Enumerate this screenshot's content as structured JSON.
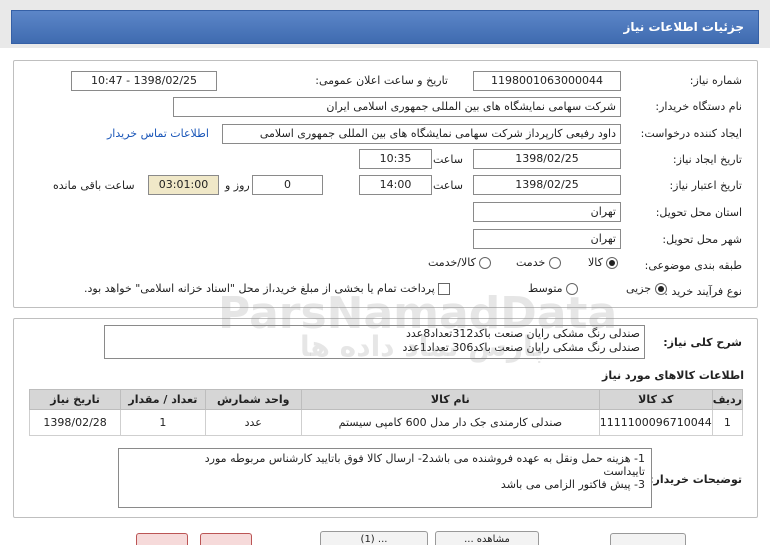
{
  "window": {
    "title": "جزئیات اطلاعات نیاز"
  },
  "details": {
    "need_number_label": "شماره نیاز:",
    "need_number": "1198001063000044",
    "announce_label": "تاریخ و ساعت اعلان عمومی:",
    "announce_value": "1398/02/25 - 10:47",
    "buyer_org_label": "نام دستگاه خریدار:",
    "buyer_org": "شرکت سهامی نمایشگاه های بین المللی جمهوری اسلامی ایران",
    "requester_label": "ایجاد کننده درخواست:",
    "requester": "داود رفیعی کارپرداز شرکت سهامی نمایشگاه های بین المللی جمهوری اسلامی",
    "contact_link": "اطلاعات تماس خریدار",
    "created_label": "تاریخ ایجاد نیاز:",
    "created_date": "1398/02/25",
    "time_label": "ساعت",
    "created_time": "10:35",
    "validity_label": "تاریخ اعتبار نیاز:",
    "validity_date": "1398/02/25",
    "validity_time": "14:00",
    "days_value": "0",
    "days_label": "روز و",
    "remaining_time": "03:01:00",
    "remaining_label": "ساعت باقی مانده",
    "province_label": "استان محل تحویل:",
    "province": "تهران",
    "city_label": "شهر محل تحویل:",
    "city": "تهران",
    "category_label": "طبقه بندی موضوعی:",
    "category_options": [
      "کالا",
      "خدمت",
      "کالا/خدمت"
    ],
    "category_selected": "کالا",
    "process_label": "نوع فرآیند خرید :",
    "process_options": [
      "جزیی",
      "متوسط"
    ],
    "process_selected": "جزیی",
    "treasury_note": "پرداخت تمام یا بخشی از مبلغ خرید،از محل \"اسناد خزانه اسلامی\" خواهد بود."
  },
  "summary": {
    "label": "شرح کلی نیاز:",
    "line1": "صندلی رنگ مشکی رایان صنعت باکد312تعداد8عدد",
    "line2": "صندلی رنگ مشکی رایان صنعت باکد306 تعداد1عدد"
  },
  "items_title": "اطلاعات کالاهای مورد نیاز",
  "items_table": {
    "headers": [
      "ردیف",
      "کد کالا",
      "نام کالا",
      "واحد شمارش",
      "تعداد / مقدار",
      "تاریخ نیاز"
    ],
    "rows": [
      [
        "1",
        "1111100096710044",
        "صندلی کارمندی جک دار مدل 600 کامپی سیستم",
        "عدد",
        "1",
        "1398/02/28"
      ]
    ]
  },
  "notes": {
    "label": "توضیحات خریدار:",
    "line1": "1- هزینه حمل ونقل به عهده فروشنده می باشد2-  ارسال کالا فوق باتایید کارشناس مربوطه مورد",
    "line2": "تاییداست",
    "line3": "3- پیش فاکتور الزامی می باشد"
  },
  "watermark": {
    "latin": "ParsNamadData",
    "persian": "پارس نماد داده ها"
  },
  "bottom_buttons": [
    "(1) ...",
    "مشاهده ..."
  ],
  "colors": {
    "header_blue": "#3f6bb0",
    "link_blue": "#1a56b8",
    "shaded_field": "#f0e8c8"
  }
}
